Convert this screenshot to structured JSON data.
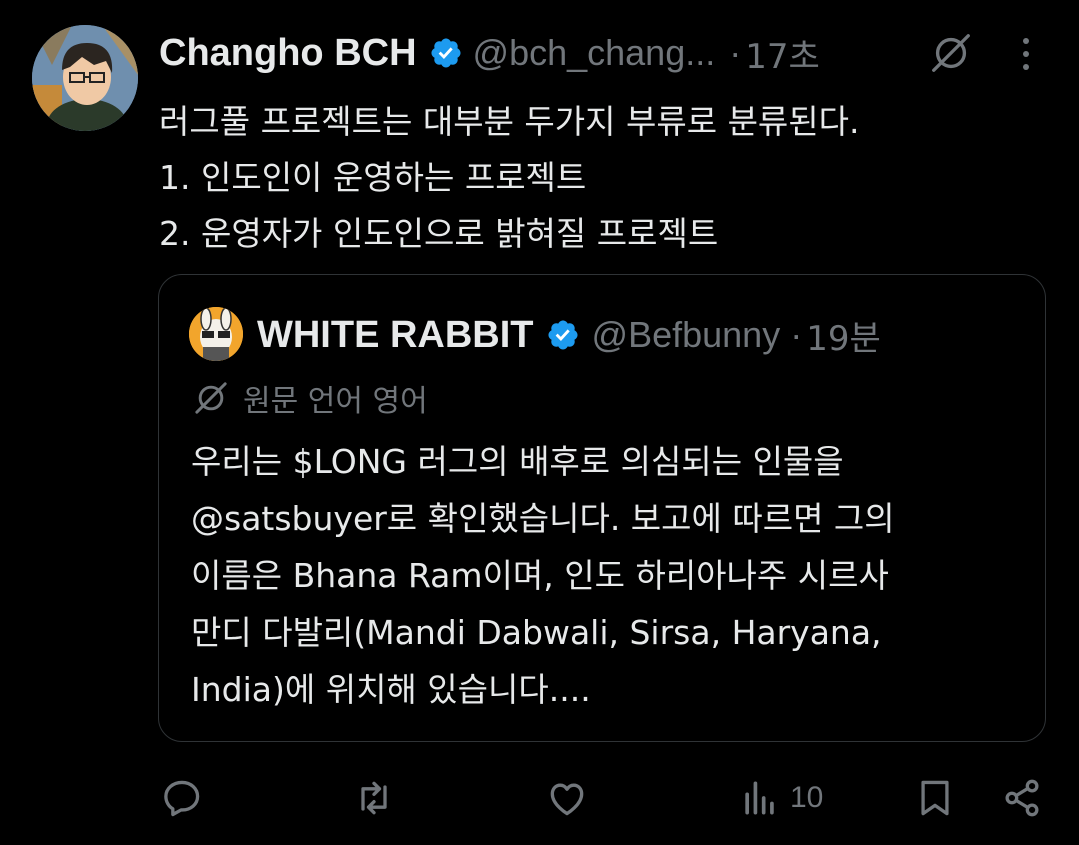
{
  "tweet": {
    "author_name": "Changho BCH",
    "author_handle": "@bch_chang...",
    "separator": "·",
    "time": "17초",
    "lines": [
      "러그풀 프로젝트는 대부분 두가지 부류로 분류된다.",
      "1. 인도인이 운영하는 프로젝트",
      "2. 운영자가 인도인으로 밝혀질 프로젝트"
    ]
  },
  "quote": {
    "author_name": "WHITE RABBIT",
    "author_handle": "@Befbunny",
    "separator": "·",
    "time": "19분",
    "original_language": "원문 언어 영어",
    "lines": [
      "우리는 $LONG 러그의 배후로 의심되는 인물을",
      "@satsbuyer로 확인했습니다. 보고에 따르면 그의",
      "이름은 Bhana Ram이며, 인도 하리아나주 시르사",
      "만디 다발리(Mandi Dabwali, Sirsa, Haryana,",
      "India)에 위치해 있습니다...."
    ]
  },
  "actions": {
    "views_count": "10"
  },
  "colors": {
    "background": "#000000",
    "text": "#e7e9ea",
    "muted": "#71767b",
    "verified": "#1d9bf0",
    "border": "#2f3336"
  },
  "icons": [
    "translate-icon",
    "more-icon",
    "verified-badge-icon",
    "reply-icon",
    "retweet-icon",
    "like-icon",
    "views-icon",
    "bookmark-icon",
    "share-icon"
  ]
}
